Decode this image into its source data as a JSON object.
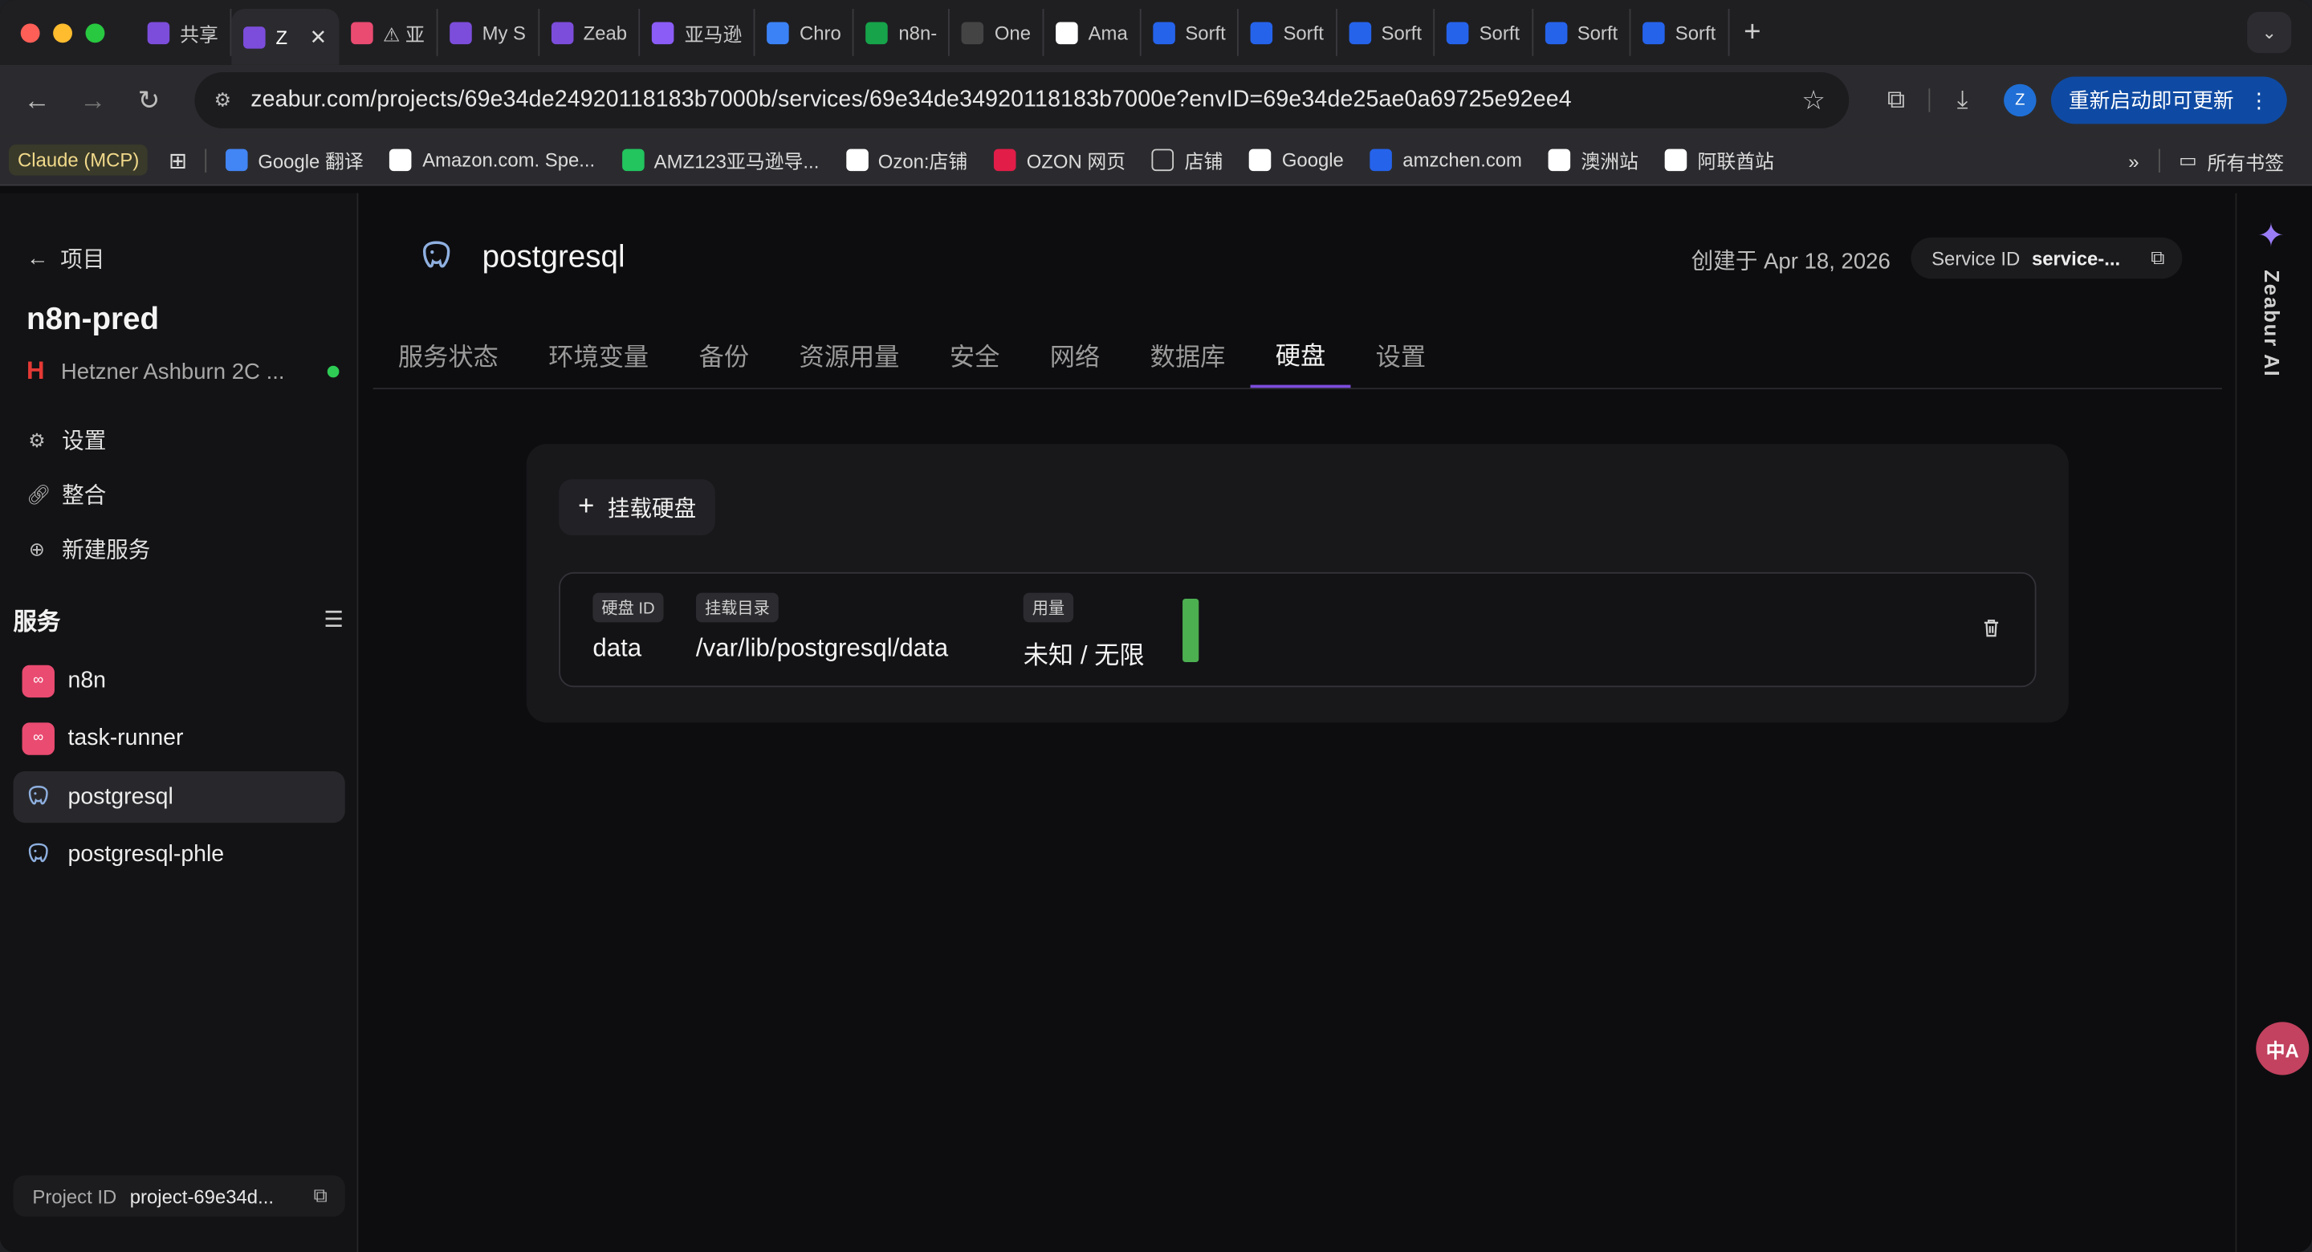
{
  "browser": {
    "tabs": [
      {
        "label": "共享",
        "icon": "zeabur-icon",
        "color": "#7c4ddb"
      },
      {
        "label": "Z",
        "icon": "zeabur-icon",
        "color": "#7c4ddb",
        "active": true
      },
      {
        "label": "⚠ 亚",
        "icon": "n8n-icon",
        "color": "#ea4b71"
      },
      {
        "label": "My S",
        "icon": "zeabur-icon",
        "color": "#7c4ddb"
      },
      {
        "label": "Zeab",
        "icon": "zeabur-icon",
        "color": "#7c4ddb"
      },
      {
        "label": "亚马逊",
        "icon": "app-icon",
        "color": "#8b5cf6"
      },
      {
        "label": "Chro",
        "icon": "gemini-icon",
        "color": "#3b82f6"
      },
      {
        "label": "n8n-",
        "icon": "drive-icon",
        "color": "#16a34a"
      },
      {
        "label": "One",
        "icon": "one-icon",
        "color": "#444444"
      },
      {
        "label": "Ama",
        "icon": "amazon-icon",
        "color": "#ffffff"
      },
      {
        "label": "Sorft",
        "icon": "sorftime-icon",
        "color": "#2563eb"
      },
      {
        "label": "Sorft",
        "icon": "sorftime-icon",
        "color": "#2563eb"
      },
      {
        "label": "Sorft",
        "icon": "sorftime-icon",
        "color": "#2563eb"
      },
      {
        "label": "Sorft",
        "icon": "sorftime-icon",
        "color": "#2563eb"
      },
      {
        "label": "Sorft",
        "icon": "sorftime-icon",
        "color": "#2563eb"
      },
      {
        "label": "Sorft",
        "icon": "sorftime-icon",
        "color": "#2563eb"
      }
    ],
    "url": "zeabur.com/projects/69e34de24920118183b7000b/services/69e34de34920118183b7000e?envID=69e34de25ae0a69725e92ee4",
    "update_label": "重新启动即可更新",
    "avatar_letter": "Z",
    "bookmarks": [
      {
        "label": "Google 翻译",
        "icon": "google-translate-icon",
        "color": "#4285f4"
      },
      {
        "label": "Amazon.com. Spe...",
        "icon": "amazon-icon",
        "color": "#ffffff"
      },
      {
        "label": "AMZ123亚马逊导...",
        "icon": "amz123-icon",
        "color": "#22c55e"
      },
      {
        "label": "Ozon:店铺",
        "icon": "ozon-icon",
        "color": "#ffffff"
      },
      {
        "label": "OZON 网页",
        "icon": "ozon-icon",
        "color": "#e11d48"
      },
      {
        "label": "店铺",
        "icon": "folder-icon",
        "color": "#cccccc"
      },
      {
        "label": "Google",
        "icon": "google-icon",
        "color": "#ffffff"
      },
      {
        "label": "amzchen.com",
        "icon": "amzchen-icon",
        "color": "#2563eb"
      },
      {
        "label": "澳洲站",
        "icon": "amazon-icon",
        "color": "#ffffff"
      },
      {
        "label": "阿联酋站",
        "icon": "amazon-icon",
        "color": "#ffffff"
      }
    ],
    "claude_bookmark": "Claude (MCP)",
    "all_bookmarks": "所有书签"
  },
  "sidebar": {
    "back_label": "项目",
    "project_name": "n8n-pred",
    "region": "Hetzner Ashburn 2C ...",
    "nav": [
      {
        "label": "设置",
        "icon": "gear-icon"
      },
      {
        "label": "整合",
        "icon": "link-icon"
      },
      {
        "label": "新建服务",
        "icon": "plus-circle-icon"
      }
    ],
    "services_title": "服务",
    "services": [
      {
        "label": "n8n",
        "icon": "n8n-icon"
      },
      {
        "label": "task-runner",
        "icon": "n8n-icon"
      },
      {
        "label": "postgresql",
        "icon": "postgresql-icon",
        "active": true
      },
      {
        "label": "postgresql-phle",
        "icon": "postgresql-icon"
      }
    ],
    "project_id_label": "Project ID",
    "project_id_value": "project-69e34d..."
  },
  "main": {
    "service_name": "postgresql",
    "created": "创建于 Apr 18, 2026",
    "service_id_label": "Service ID",
    "service_id_value": "service-...",
    "tabs": [
      "服务状态",
      "环境变量",
      "备份",
      "资源用量",
      "安全",
      "网络",
      "数据库",
      "硬盘",
      "设置"
    ],
    "active_tab": 7,
    "mount_button": "挂载硬盘",
    "disk": {
      "id_label": "硬盘 ID",
      "id_value": "data",
      "path_label": "挂载目录",
      "path_value": "/var/lib/postgresql/data",
      "usage_label": "用量",
      "usage_value": "未知 / 无限"
    }
  },
  "right_panel": {
    "ai_label": "Zeabur AI"
  }
}
